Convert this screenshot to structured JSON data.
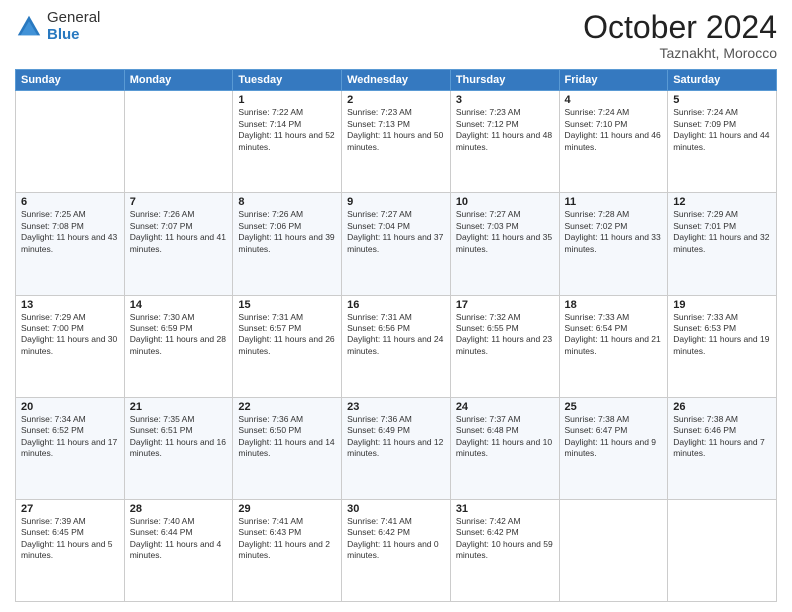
{
  "header": {
    "logo_general": "General",
    "logo_blue": "Blue",
    "month_title": "October 2024",
    "location": "Taznakht, Morocco"
  },
  "weekdays": [
    "Sunday",
    "Monday",
    "Tuesday",
    "Wednesday",
    "Thursday",
    "Friday",
    "Saturday"
  ],
  "rows": [
    [
      {
        "day": "",
        "sunrise": "",
        "sunset": "",
        "daylight": ""
      },
      {
        "day": "",
        "sunrise": "",
        "sunset": "",
        "daylight": ""
      },
      {
        "day": "1",
        "sunrise": "Sunrise: 7:22 AM",
        "sunset": "Sunset: 7:14 PM",
        "daylight": "Daylight: 11 hours and 52 minutes."
      },
      {
        "day": "2",
        "sunrise": "Sunrise: 7:23 AM",
        "sunset": "Sunset: 7:13 PM",
        "daylight": "Daylight: 11 hours and 50 minutes."
      },
      {
        "day": "3",
        "sunrise": "Sunrise: 7:23 AM",
        "sunset": "Sunset: 7:12 PM",
        "daylight": "Daylight: 11 hours and 48 minutes."
      },
      {
        "day": "4",
        "sunrise": "Sunrise: 7:24 AM",
        "sunset": "Sunset: 7:10 PM",
        "daylight": "Daylight: 11 hours and 46 minutes."
      },
      {
        "day": "5",
        "sunrise": "Sunrise: 7:24 AM",
        "sunset": "Sunset: 7:09 PM",
        "daylight": "Daylight: 11 hours and 44 minutes."
      }
    ],
    [
      {
        "day": "6",
        "sunrise": "Sunrise: 7:25 AM",
        "sunset": "Sunset: 7:08 PM",
        "daylight": "Daylight: 11 hours and 43 minutes."
      },
      {
        "day": "7",
        "sunrise": "Sunrise: 7:26 AM",
        "sunset": "Sunset: 7:07 PM",
        "daylight": "Daylight: 11 hours and 41 minutes."
      },
      {
        "day": "8",
        "sunrise": "Sunrise: 7:26 AM",
        "sunset": "Sunset: 7:06 PM",
        "daylight": "Daylight: 11 hours and 39 minutes."
      },
      {
        "day": "9",
        "sunrise": "Sunrise: 7:27 AM",
        "sunset": "Sunset: 7:04 PM",
        "daylight": "Daylight: 11 hours and 37 minutes."
      },
      {
        "day": "10",
        "sunrise": "Sunrise: 7:27 AM",
        "sunset": "Sunset: 7:03 PM",
        "daylight": "Daylight: 11 hours and 35 minutes."
      },
      {
        "day": "11",
        "sunrise": "Sunrise: 7:28 AM",
        "sunset": "Sunset: 7:02 PM",
        "daylight": "Daylight: 11 hours and 33 minutes."
      },
      {
        "day": "12",
        "sunrise": "Sunrise: 7:29 AM",
        "sunset": "Sunset: 7:01 PM",
        "daylight": "Daylight: 11 hours and 32 minutes."
      }
    ],
    [
      {
        "day": "13",
        "sunrise": "Sunrise: 7:29 AM",
        "sunset": "Sunset: 7:00 PM",
        "daylight": "Daylight: 11 hours and 30 minutes."
      },
      {
        "day": "14",
        "sunrise": "Sunrise: 7:30 AM",
        "sunset": "Sunset: 6:59 PM",
        "daylight": "Daylight: 11 hours and 28 minutes."
      },
      {
        "day": "15",
        "sunrise": "Sunrise: 7:31 AM",
        "sunset": "Sunset: 6:57 PM",
        "daylight": "Daylight: 11 hours and 26 minutes."
      },
      {
        "day": "16",
        "sunrise": "Sunrise: 7:31 AM",
        "sunset": "Sunset: 6:56 PM",
        "daylight": "Daylight: 11 hours and 24 minutes."
      },
      {
        "day": "17",
        "sunrise": "Sunrise: 7:32 AM",
        "sunset": "Sunset: 6:55 PM",
        "daylight": "Daylight: 11 hours and 23 minutes."
      },
      {
        "day": "18",
        "sunrise": "Sunrise: 7:33 AM",
        "sunset": "Sunset: 6:54 PM",
        "daylight": "Daylight: 11 hours and 21 minutes."
      },
      {
        "day": "19",
        "sunrise": "Sunrise: 7:33 AM",
        "sunset": "Sunset: 6:53 PM",
        "daylight": "Daylight: 11 hours and 19 minutes."
      }
    ],
    [
      {
        "day": "20",
        "sunrise": "Sunrise: 7:34 AM",
        "sunset": "Sunset: 6:52 PM",
        "daylight": "Daylight: 11 hours and 17 minutes."
      },
      {
        "day": "21",
        "sunrise": "Sunrise: 7:35 AM",
        "sunset": "Sunset: 6:51 PM",
        "daylight": "Daylight: 11 hours and 16 minutes."
      },
      {
        "day": "22",
        "sunrise": "Sunrise: 7:36 AM",
        "sunset": "Sunset: 6:50 PM",
        "daylight": "Daylight: 11 hours and 14 minutes."
      },
      {
        "day": "23",
        "sunrise": "Sunrise: 7:36 AM",
        "sunset": "Sunset: 6:49 PM",
        "daylight": "Daylight: 11 hours and 12 minutes."
      },
      {
        "day": "24",
        "sunrise": "Sunrise: 7:37 AM",
        "sunset": "Sunset: 6:48 PM",
        "daylight": "Daylight: 11 hours and 10 minutes."
      },
      {
        "day": "25",
        "sunrise": "Sunrise: 7:38 AM",
        "sunset": "Sunset: 6:47 PM",
        "daylight": "Daylight: 11 hours and 9 minutes."
      },
      {
        "day": "26",
        "sunrise": "Sunrise: 7:38 AM",
        "sunset": "Sunset: 6:46 PM",
        "daylight": "Daylight: 11 hours and 7 minutes."
      }
    ],
    [
      {
        "day": "27",
        "sunrise": "Sunrise: 7:39 AM",
        "sunset": "Sunset: 6:45 PM",
        "daylight": "Daylight: 11 hours and 5 minutes."
      },
      {
        "day": "28",
        "sunrise": "Sunrise: 7:40 AM",
        "sunset": "Sunset: 6:44 PM",
        "daylight": "Daylight: 11 hours and 4 minutes."
      },
      {
        "day": "29",
        "sunrise": "Sunrise: 7:41 AM",
        "sunset": "Sunset: 6:43 PM",
        "daylight": "Daylight: 11 hours and 2 minutes."
      },
      {
        "day": "30",
        "sunrise": "Sunrise: 7:41 AM",
        "sunset": "Sunset: 6:42 PM",
        "daylight": "Daylight: 11 hours and 0 minutes."
      },
      {
        "day": "31",
        "sunrise": "Sunrise: 7:42 AM",
        "sunset": "Sunset: 6:42 PM",
        "daylight": "Daylight: 10 hours and 59 minutes."
      },
      {
        "day": "",
        "sunrise": "",
        "sunset": "",
        "daylight": ""
      },
      {
        "day": "",
        "sunrise": "",
        "sunset": "",
        "daylight": ""
      }
    ]
  ]
}
